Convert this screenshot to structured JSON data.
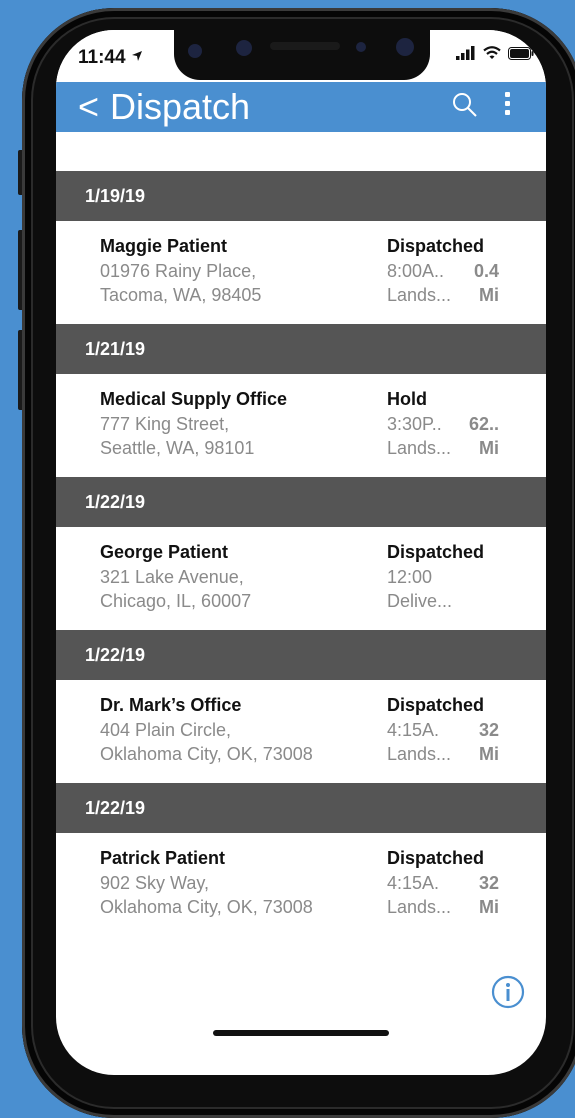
{
  "status_bar": {
    "time": "11:44",
    "location_icon": "location-arrow-icon",
    "signal_icon": "cellular-signal-icon",
    "wifi_icon": "wifi-icon",
    "battery_icon": "battery-icon"
  },
  "header": {
    "back_label": "<",
    "title": "Dispatch",
    "search_icon": "search-icon",
    "more_icon": "more-vertical-icon",
    "background": "#4a8fd0"
  },
  "groups": [
    {
      "date": "1/19/19",
      "items": [
        {
          "name": "Maggie Patient",
          "address_line1": "01976 Rainy Place,",
          "address_line2": "Tacoma, WA, 98405",
          "status": "Dispatched",
          "time": "8:00A..",
          "type": "Lands...",
          "distance": "0.4",
          "unit": "Mi"
        }
      ]
    },
    {
      "date": "1/21/19",
      "items": [
        {
          "name": "Medical Supply Office",
          "address_line1": "777 King Street,",
          "address_line2": "Seattle, WA, 98101",
          "status": "Hold",
          "time": "3:30P..",
          "type": "Lands...",
          "distance": "62..",
          "unit": "Mi"
        }
      ]
    },
    {
      "date": "1/22/19",
      "items": [
        {
          "name": "George Patient",
          "address_line1": "321 Lake Avenue,",
          "address_line2": "Chicago, IL, 60007",
          "status": "Dispatched",
          "time": "12:00",
          "type": "Delive...",
          "distance": "",
          "unit": ""
        }
      ]
    },
    {
      "date": "1/22/19",
      "items": [
        {
          "name": "Dr. Mark’s Office",
          "address_line1": "404 Plain Circle,",
          "address_line2": "Oklahoma City, OK, 73008",
          "status": "Dispatched",
          "time": "4:15A.",
          "type": "Lands...",
          "distance": "32",
          "unit": "Mi"
        }
      ]
    },
    {
      "date": "1/22/19",
      "items": [
        {
          "name": "Patrick Patient",
          "address_line1": "902 Sky Way,",
          "address_line2": "Oklahoma City, OK, 73008",
          "status": "Dispatched",
          "time": "4:15A.",
          "type": "Lands...",
          "distance": "32",
          "unit": "Mi"
        }
      ]
    }
  ],
  "footer": {
    "info_icon": "info-circle-icon"
  },
  "colors": {
    "accent": "#4a8fd0",
    "group_header": "#555555",
    "secondary_text": "#8a8a8a"
  }
}
